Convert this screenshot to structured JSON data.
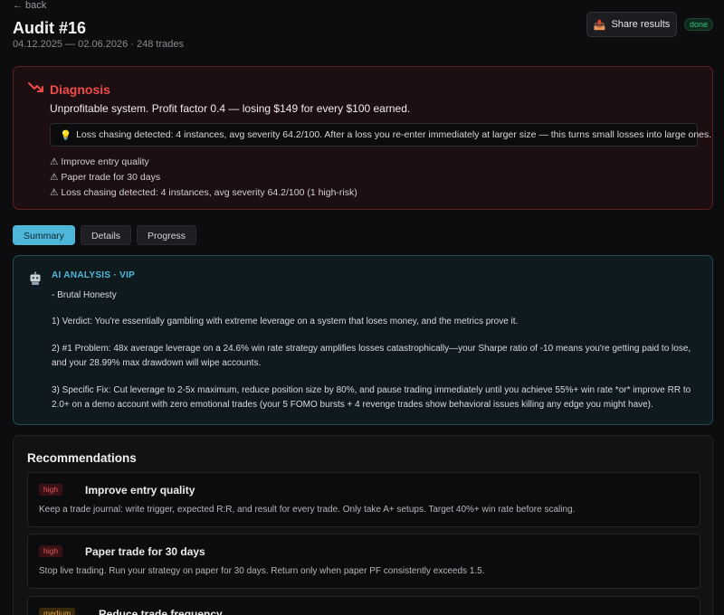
{
  "nav": {
    "back_label": "← back"
  },
  "header": {
    "title": "Audit #16",
    "subtitle": "04.12.2025 — 02.06.2026 · 248 trades",
    "share_label": "Share results",
    "status": "done"
  },
  "diagnosis": {
    "title": "Diagnosis",
    "summary": "Unprofitable system. Profit factor 0.4 — losing $149 for every $100 earned.",
    "insight": "Loss chasing detected: 4 instances, avg severity 64.2/100. After a loss you re-enter immediately at larger size — this turns small losses into large ones.",
    "warnings": [
      "⚠ Improve entry quality",
      "⚠ Paper trade for 30 days",
      "⚠ Loss chasing detected: 4 instances, avg severity 64.2/100 (1 high-risk)"
    ],
    "accent_color": "#ef4b4b"
  },
  "tabs": [
    {
      "label": "Summary",
      "active": true
    },
    {
      "label": "Details",
      "active": false
    },
    {
      "label": "Progress",
      "active": false
    }
  ],
  "ai_analysis": {
    "title": "AI ANALYSIS · VIP",
    "paragraphs": [
      "- Brutal Honesty",
      "1) Verdict: You're essentially gambling with extreme leverage on a system that loses money, and the metrics prove it.",
      "2) #1 Problem: 48x average leverage on a 24.6% win rate strategy amplifies losses catastrophically—your Sharpe ratio of -10 means you're getting paid to lose, and your 28.99% max drawdown will wipe accounts.",
      "3) Specific Fix: Cut leverage to 2-5x maximum, reduce position size by 80%, and pause trading immediately until you achieve 55%+ win rate *or* improve RR to 2.0+ on a demo account with zero emotional trades (your 5 FOMO bursts + 4 revenge trades show behavioral issues killing any edge you might have)."
    ],
    "accent_color": "#4fb8d9"
  },
  "recommendations": {
    "title": "Recommendations",
    "items": [
      {
        "priority": "high",
        "title": "Improve entry quality",
        "description": "Keep a trade journal: write trigger, expected R:R, and result for every trade. Only take A+ setups. Target 40%+ win rate before scaling."
      },
      {
        "priority": "high",
        "title": "Paper trade for 30 days",
        "description": "Stop live trading. Run your strategy on paper for 30 days. Return only when paper PF consistently exceeds 1.5."
      },
      {
        "priority": "medium",
        "title": "Reduce trade frequency",
        "description": ""
      }
    ]
  }
}
